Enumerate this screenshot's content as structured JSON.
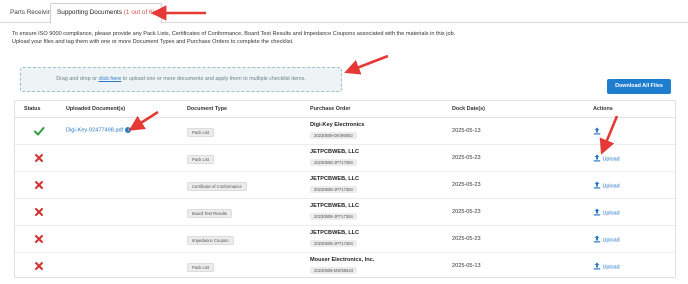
{
  "tabs": [
    {
      "label": "Parts Receiving"
    },
    {
      "label": "Supporting Documents",
      "count": "(1 out of 6)"
    }
  ],
  "intro": {
    "line1": "To ensure ISO 9000 compliance, please provide any Pack Lists, Certificates of Conformance, Board Test Results and Impedance Coupons associated with the materials in this job.",
    "line2": "Upload your files and tag them with one or more Document Types and Purchase Orders to complete the checklist."
  },
  "dropzone": {
    "before": "Drag and drop or ",
    "link": "click here",
    "after": " to upload one or more documents and apply them to multiple checklist items."
  },
  "download_all_label": "Download All Files",
  "table": {
    "headers": {
      "status": "Status",
      "uploaded": "Uploaded Document(s)",
      "doc_type": "Document Type",
      "po": "Purchase Order",
      "dock": "Dock Date(s)",
      "actions": "Actions"
    },
    "rows": [
      {
        "status": "complete",
        "doc": "Digi-Key-92477498.pdf",
        "type": "Pack List",
        "vendor": "Digi-Key Electronics",
        "po": "20230508-DK/86653",
        "date": "2025-05-13",
        "action": ""
      },
      {
        "status": "missing",
        "doc": "",
        "type": "Pack List",
        "vendor": "JETPCBWEB, LLC",
        "po": "20230508-JP717384",
        "date": "2025-05-23",
        "action": "Upload"
      },
      {
        "status": "missing",
        "doc": "",
        "type": "Certificate of Conformance",
        "vendor": "JETPCBWEB, LLC",
        "po": "20230508-JP717384",
        "date": "2025-05-23",
        "action": "Upload"
      },
      {
        "status": "missing",
        "doc": "",
        "type": "Board Test Results",
        "vendor": "JETPCBWEB, LLC",
        "po": "20230508-JP717384",
        "date": "2025-05-23",
        "action": "Upload"
      },
      {
        "status": "missing",
        "doc": "",
        "type": "Impedance Coupon",
        "vendor": "JETPCBWEB, LLC",
        "po": "20230508-JP717384",
        "date": "2025-05-23",
        "action": "Upload"
      },
      {
        "status": "missing",
        "doc": "",
        "type": "Pack List",
        "vendor": "Mouser Electronics, Inc.",
        "po": "20230508-MS/66624",
        "date": "2025-05-13",
        "action": "Upload"
      }
    ]
  },
  "colors": {
    "accent": "#1f7dd0",
    "success": "#2e9c3f",
    "error": "#d32f2f",
    "annotation": "#e53935"
  },
  "icons": [
    "check-icon",
    "x-icon",
    "upload-icon",
    "info-icon",
    "annotation-arrow"
  ]
}
